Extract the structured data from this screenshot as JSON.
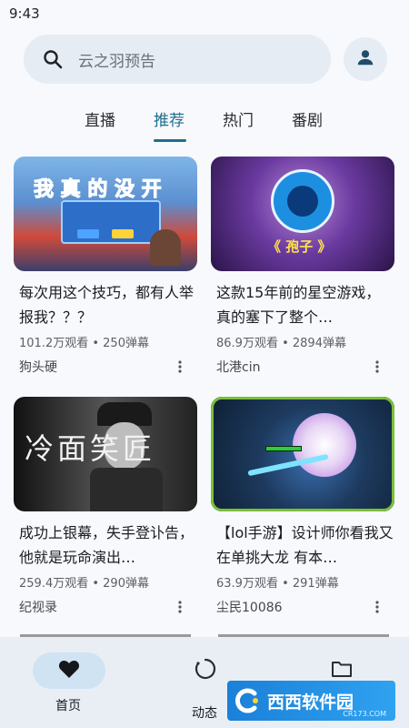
{
  "status": {
    "time": "9:43"
  },
  "search": {
    "placeholder": "云之羽预告"
  },
  "tabs": [
    {
      "label": "直播",
      "active": false
    },
    {
      "label": "推荐",
      "active": true
    },
    {
      "label": "热门",
      "active": false
    },
    {
      "label": "番剧",
      "active": false
    }
  ],
  "videos": [
    {
      "title": "每次用这个技巧，都有人举报我？？？",
      "stats": "101.2万观看 • 250弹幕",
      "author": "狗头硬",
      "thumb_text": "我 真 的 没 开"
    },
    {
      "title": "这款15年前的星空游戏，真的塞下了整个…",
      "stats": "86.9万观看 • 2894弹幕",
      "author": "北港cin",
      "thumb_text": "《 孢子 》"
    },
    {
      "title": "成功上银幕，失手登讣告，他就是玩命演出…",
      "stats": "259.4万观看 • 290弹幕",
      "author": "纪视录",
      "thumb_text": "冷面笑匠"
    },
    {
      "title": "【lol手游】设计师你看我又在单挑大龙 有本…",
      "stats": "63.9万观看 • 291弹幕",
      "author": "尘民10086",
      "thumb_text": ""
    }
  ],
  "bottom_nav": [
    {
      "label": "首页",
      "icon": "heart-icon",
      "active": true
    },
    {
      "label": "动态",
      "icon": "refresh-icon",
      "active": false
    },
    {
      "label": "",
      "icon": "folder-icon",
      "active": false
    }
  ],
  "watermark": {
    "text": "西西软件园",
    "sub": "CR173.COM"
  },
  "colors": {
    "accent": "#1f6e8f",
    "background": "#f7f9fc",
    "nav_background": "#e9eef5"
  }
}
